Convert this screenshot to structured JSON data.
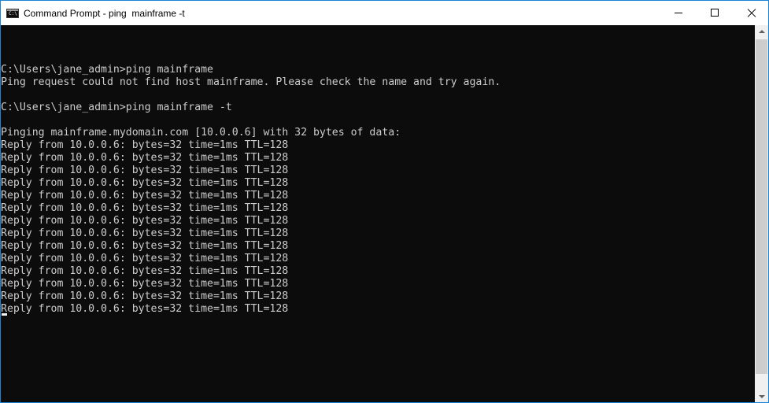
{
  "window": {
    "title": "Command Prompt - ping  mainframe -t",
    "icon_label": "C:\\",
    "accent_color": "#1883d7"
  },
  "controls": {
    "minimize": "minimize-icon",
    "maximize": "maximize-icon",
    "close": "close-icon"
  },
  "console": {
    "background": "#0c0c0c",
    "foreground": "#cccccc",
    "lines": [
      "",
      "C:\\Users\\jane_admin>ping mainframe",
      "Ping request could not find host mainframe. Please check the name and try again.",
      "",
      "C:\\Users\\jane_admin>ping mainframe -t",
      "",
      "Pinging mainframe.mydomain.com [10.0.0.6] with 32 bytes of data:",
      "Reply from 10.0.0.6: bytes=32 time=1ms TTL=128",
      "Reply from 10.0.0.6: bytes=32 time=1ms TTL=128",
      "Reply from 10.0.0.6: bytes=32 time=1ms TTL=128",
      "Reply from 10.0.0.6: bytes=32 time=1ms TTL=128",
      "Reply from 10.0.0.6: bytes=32 time=1ms TTL=128",
      "Reply from 10.0.0.6: bytes=32 time=1ms TTL=128",
      "Reply from 10.0.0.6: bytes=32 time=1ms TTL=128",
      "Reply from 10.0.0.6: bytes=32 time=1ms TTL=128",
      "Reply from 10.0.0.6: bytes=32 time=1ms TTL=128",
      "Reply from 10.0.0.6: bytes=32 time=1ms TTL=128",
      "Reply from 10.0.0.6: bytes=32 time=1ms TTL=128",
      "Reply from 10.0.0.6: bytes=32 time=1ms TTL=128",
      "Reply from 10.0.0.6: bytes=32 time=1ms TTL=128",
      "Reply from 10.0.0.6: bytes=32 time=1ms TTL=128"
    ]
  }
}
